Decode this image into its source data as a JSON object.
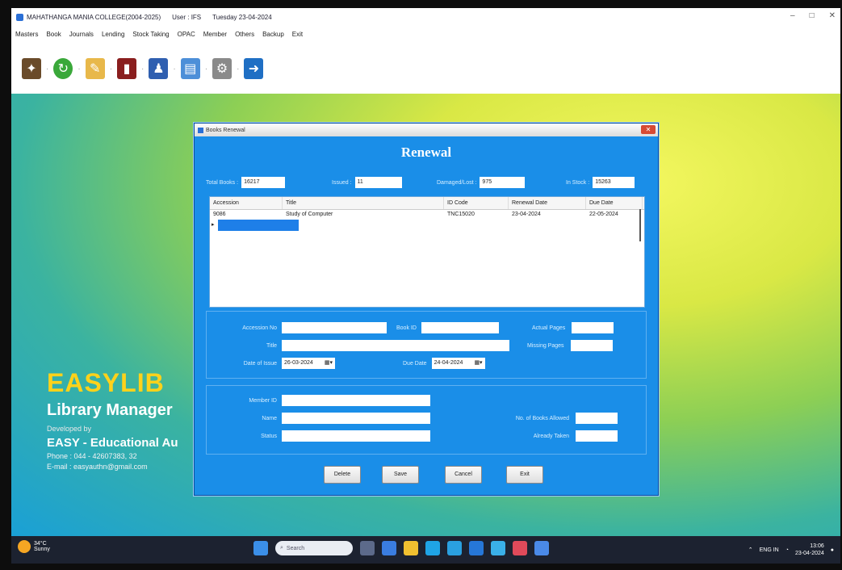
{
  "window": {
    "title": "MAHATHANGA MANIA COLLEGE(2004-2025)",
    "user": "User : IFS",
    "date": "Tuesday 23-04-2024",
    "controls": [
      "–",
      "□",
      "✕"
    ]
  },
  "menu": [
    "Masters",
    "Book",
    "Journals",
    "Lending",
    "Stock Taking",
    "OPAC",
    "Member",
    "Others",
    "Backup",
    "Exit"
  ],
  "toolbar": [
    "issue-icon",
    "refresh-icon",
    "edit-icon",
    "books-icon",
    "users-icon",
    "report-icon",
    "settings-icon",
    "exit-icon"
  ],
  "brand": {
    "name": "EASYLIB",
    "tagline": "Library Manager",
    "developed_by": "Developed by",
    "company": "EASY - Educational Au",
    "phone": "Phone : 044 - 42607383, 32",
    "email": "E-mail : easyauthn@gmail.com"
  },
  "dialog": {
    "title": "Books Renewal",
    "close": "✕",
    "heading": "Renewal",
    "stats": {
      "total_label": "Total Books :",
      "total_value": "16217",
      "issued_label": "Issued :",
      "issued_value": "11",
      "damaged_label": "Damaged/Lost :",
      "damaged_value": "975",
      "instock_label": "In Stock :",
      "instock_value": "15263"
    },
    "grid": {
      "columns": [
        "Accession",
        "Title",
        "ID Code",
        "Renewal Date",
        "Due Date"
      ],
      "rows": [
        {
          "accession": "9086",
          "title": "Study of Computer",
          "id_code": "TNC15020",
          "renewal_date": "23-04-2024",
          "due_date": "22-05-2024"
        }
      ]
    },
    "book": {
      "accession_label": "Accession No",
      "accession_value": "",
      "bookid_label": "Book ID",
      "bookid_value": "",
      "actualpages_label": "Actual Pages",
      "actualpages_value": "",
      "title_label": "Title",
      "title_value": "",
      "missingpages_label": "Missing Pages",
      "missingpages_value": "",
      "issue_label": "Date of Issue",
      "issue_value": "26-03-2024",
      "due_label": "Due Date",
      "due_value": "24-04-2024"
    },
    "member": {
      "id_label": "Member ID",
      "id_value": "",
      "name_label": "Name",
      "name_value": "",
      "status_label": "Status",
      "status_value": "",
      "allowed_label": "No. of Books Allowed",
      "allowed_value": "",
      "taken_label": "Already Taken",
      "taken_value": ""
    },
    "buttons": {
      "delete": "Delete",
      "save": "Save",
      "cancel": "Cancel",
      "exit": "Exit"
    }
  },
  "taskbar": {
    "weather_temp": "34°C",
    "weather_text": "Sunny",
    "search_placeholder": "Search",
    "tray_lang": "ENG IN",
    "time": "13:06",
    "date": "23-04-2024"
  }
}
